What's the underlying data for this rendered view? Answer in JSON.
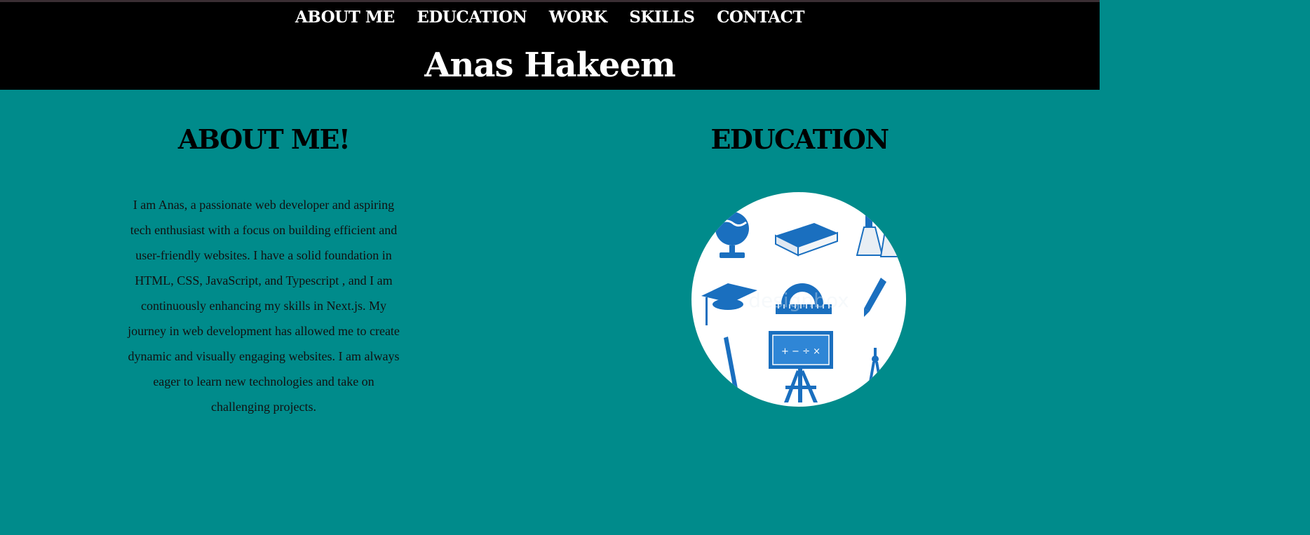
{
  "nav": {
    "items": [
      "ABOUT ME",
      "EDUCATION",
      "WORK",
      "SKILLS",
      "CONTACT"
    ]
  },
  "brand": {
    "name": "Anas Hakeem"
  },
  "about": {
    "title": "ABOUT ME!",
    "text": "I am Anas, a passionate web developer and aspiring tech enthusiast with a focus on building efficient and user-friendly websites. I have a solid foundation in HTML, CSS, JavaScript, and Typescript , and I am continuously enhancing my skills in Next.js. My journey in web development has allowed me to create dynamic and visually engaging websites. I am always eager to learn new technologies and take on challenging projects."
  },
  "education": {
    "title": "EDUCATION",
    "image_icons": [
      "globe-icon",
      "book-icon",
      "flask-icon",
      "graduation-cap-icon",
      "protractor-icon",
      "pen-icon",
      "pencil-icon",
      "blackboard-icon",
      "compass-icon"
    ],
    "board_symbols": "+ − ÷ ×"
  },
  "colors": {
    "background": "#008b8b",
    "header": "#000000",
    "icon_blue": "#1a6fbf"
  }
}
